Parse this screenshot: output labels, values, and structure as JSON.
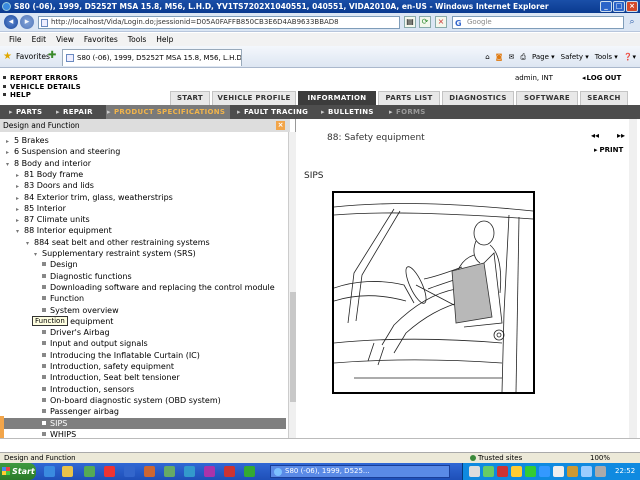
{
  "browser": {
    "title": "S80 (-06), 1999, D5252T MSA 15.8, M56, L.H.D, YV1TS7202X1040551, 040551, VIDA2010A, en-US - Windows Internet Explorer",
    "url": "http://localhost/Vida/Login.do;jsessionid=D05A0FAFFB850CB3E6D4AB9633BBAD8",
    "search_placeholder": "Google",
    "menu": [
      "File",
      "Edit",
      "View",
      "Favorites",
      "Tools",
      "Help"
    ],
    "favorites_label": "Favorites",
    "tab_title": "S80 (-06), 1999, D5252T MSA 15.8, M56, L.H.D, YV1...",
    "commands": [
      "Page ▾",
      "Safety ▾",
      "Tools ▾",
      "❓▾"
    ]
  },
  "app": {
    "header_links": [
      "REPORT ERRORS",
      "VEHICLE DETAILS",
      "HELP"
    ],
    "user": "admin, INT",
    "logout": "LOG OUT",
    "top_tabs": [
      {
        "label": "START",
        "active": false
      },
      {
        "label": "VEHICLE PROFILE",
        "active": false
      },
      {
        "label": "INFORMATION",
        "active": true
      },
      {
        "label": "PARTS LIST",
        "active": false
      },
      {
        "label": "DIAGNOSTICS",
        "active": false
      },
      {
        "label": "SOFTWARE",
        "active": false
      },
      {
        "label": "SEARCH",
        "active": false
      }
    ],
    "sub_nav": [
      {
        "label": "PARTS",
        "state": "normal"
      },
      {
        "label": "REPAIR",
        "state": "normal"
      },
      {
        "label": "PRODUCT SPECIFICATIONS",
        "state": "selected"
      },
      {
        "label": "FAULT TRACING",
        "state": "normal"
      },
      {
        "label": "BULLETINS",
        "state": "normal"
      },
      {
        "label": "FORMS",
        "state": "dim"
      }
    ]
  },
  "left_pane": {
    "title": "Design and Function",
    "close": "×",
    "tree": [
      {
        "label": "5 Brakes",
        "level": 1,
        "type": "collapsed"
      },
      {
        "label": "6 Suspension and steering",
        "level": 1,
        "type": "collapsed"
      },
      {
        "label": "8 Body and interior",
        "level": 1,
        "type": "expanded"
      },
      {
        "label": "81 Body frame",
        "level": 2,
        "type": "collapsed"
      },
      {
        "label": "83 Doors and lids",
        "level": 2,
        "type": "collapsed"
      },
      {
        "label": "84 Exterior trim, glass, weatherstrips",
        "level": 2,
        "type": "collapsed"
      },
      {
        "label": "85 Interior",
        "level": 2,
        "type": "collapsed"
      },
      {
        "label": "87 Climate units",
        "level": 2,
        "type": "collapsed"
      },
      {
        "label": "88 Interior equipment",
        "level": 2,
        "type": "expanded"
      },
      {
        "label": "884 seat belt and other restraining systems",
        "level": 3,
        "type": "expanded"
      },
      {
        "label": "Supplementary restraint system (SRS)",
        "level": 4,
        "type": "expanded"
      },
      {
        "label": "Design",
        "level": 5,
        "type": "leaf"
      },
      {
        "label": "Diagnostic functions",
        "level": 5,
        "type": "leaf"
      },
      {
        "label": "Downloading software and replacing the control module",
        "level": 5,
        "type": "leaf"
      },
      {
        "label": "Function",
        "level": 5,
        "type": "leaf"
      },
      {
        "label": "System overview",
        "level": 5,
        "type": "leaf"
      },
      {
        "label": "Safety equipment",
        "level": 4,
        "type": "expanded"
      },
      {
        "label": "Driver's Airbag",
        "level": 5,
        "type": "leaf"
      },
      {
        "label": "Input and output signals",
        "level": 5,
        "type": "leaf"
      },
      {
        "label": "Introducing the Inflatable Curtain (IC)",
        "level": 5,
        "type": "leaf"
      },
      {
        "label": "Introduction, safety equipment",
        "level": 5,
        "type": "leaf"
      },
      {
        "label": "Introduction, Seat belt tensioner",
        "level": 5,
        "type": "leaf"
      },
      {
        "label": "Introduction, sensors",
        "level": 5,
        "type": "leaf"
      },
      {
        "label": "On-board diagnostic system (OBD system)",
        "level": 5,
        "type": "leaf"
      },
      {
        "label": "Passenger airbag",
        "level": 5,
        "type": "leaf"
      },
      {
        "label": "SIPS",
        "level": 5,
        "type": "leaf",
        "selected": true
      },
      {
        "label": "WHIPS",
        "level": 5,
        "type": "leaf"
      }
    ],
    "tooltip": "Function"
  },
  "right_pane": {
    "doc_title": "88: Safety equipment",
    "prev": "◂◂",
    "next": "▸▸",
    "print": "PRINT",
    "section_title": "SIPS"
  },
  "status": {
    "text": "Design and Function",
    "zone": "Trusted sites",
    "zoom": "100%"
  },
  "taskbar": {
    "start": "Start",
    "task_title": "S80 (-06), 1999, D525...",
    "clock": "22:52"
  }
}
